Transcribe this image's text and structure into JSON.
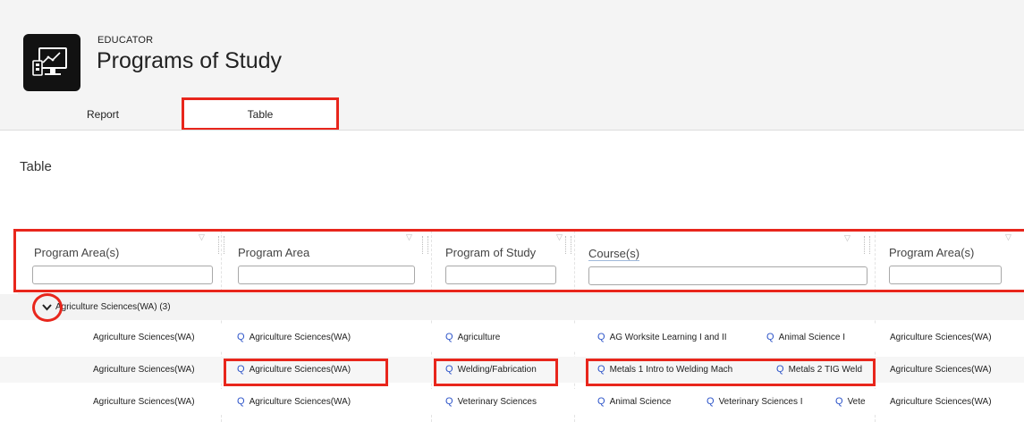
{
  "app": {
    "category": "EDUCATOR",
    "title": "Programs of Study",
    "icon": "monitor-chart-icon"
  },
  "tabs": [
    {
      "label": "Report"
    },
    {
      "label": "Table"
    }
  ],
  "section_title": "Table",
  "table": {
    "columns": [
      {
        "label": "Program Area(s)"
      },
      {
        "label": "Program Area"
      },
      {
        "label": "Program of Study"
      },
      {
        "label": "Course(s)"
      },
      {
        "label": "Program Area(s)"
      }
    ],
    "group": {
      "label": "Agriculture Sciences(WA) (3)"
    },
    "rows": [
      {
        "program_areas": "Agriculture Sciences(WA)",
        "program_area": "Agriculture Sciences(WA)",
        "program_of_study": "Agriculture",
        "courses": [
          "AG Worksite Learning I and II",
          "Animal Science I"
        ],
        "program_areas_2": "Agriculture Sciences(WA)"
      },
      {
        "program_areas": "Agriculture Sciences(WA)",
        "program_area": "Agriculture Sciences(WA)",
        "program_of_study": "Welding/Fabrication",
        "courses": [
          "Metals 1 Intro to Welding Mach",
          "Metals 2 TIG Weld"
        ],
        "program_areas_2": "Agriculture Sciences(WA)"
      },
      {
        "program_areas": "Agriculture Sciences(WA)",
        "program_area": "Agriculture Sciences(WA)",
        "program_of_study": "Veterinary Sciences",
        "courses": [
          "Animal Science",
          "Veterinary Sciences I",
          "Vete"
        ],
        "program_areas_2": "Agriculture Sciences(WA)"
      }
    ]
  },
  "colors": {
    "highlight": "#e8261c",
    "link_icon": "#2e55c9",
    "header_bg": "#f4f4f4"
  }
}
